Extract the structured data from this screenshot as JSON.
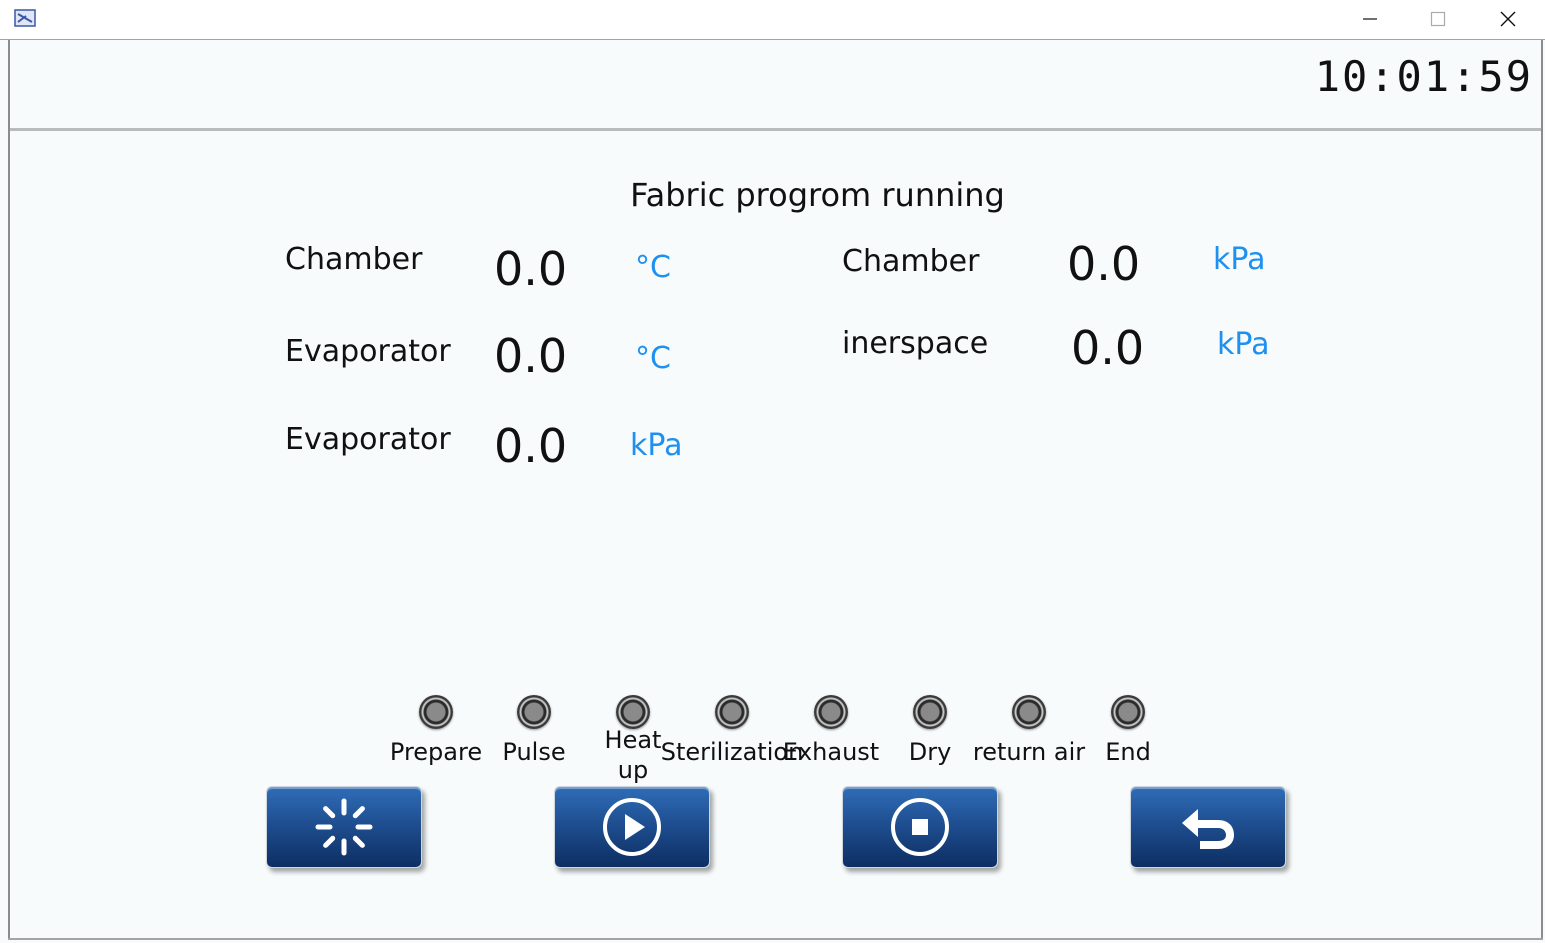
{
  "header": {
    "clock": "10:01:59"
  },
  "main": {
    "title": "Fabric progrom running",
    "readings_left": [
      {
        "label": "Chamber",
        "value": "0.0",
        "unit": "°C"
      },
      {
        "label": "Evaporator",
        "value": "0.0",
        "unit": "°C"
      },
      {
        "label": "Evaporator",
        "value": "0.0",
        "unit": "kPa"
      }
    ],
    "readings_right": [
      {
        "label": "Chamber",
        "value": "0.0",
        "unit": "kPa"
      },
      {
        "label": "inerspace",
        "value": "0.0",
        "unit": "kPa"
      }
    ]
  },
  "steps": [
    {
      "label": "Prepare"
    },
    {
      "label": "Pulse"
    },
    {
      "label": "Heat up"
    },
    {
      "label": "Sterilization"
    },
    {
      "label": "Exhaust"
    },
    {
      "label": "Dry"
    },
    {
      "label": "return air"
    },
    {
      "label": "End"
    }
  ],
  "controls": [
    {
      "icon": "loading-icon"
    },
    {
      "icon": "play-icon"
    },
    {
      "icon": "stop-icon"
    },
    {
      "icon": "back-arrow-icon"
    }
  ],
  "colors": {
    "unit": "#1e90f0",
    "button": "#1f4f91",
    "background": "#f7fbfb"
  }
}
